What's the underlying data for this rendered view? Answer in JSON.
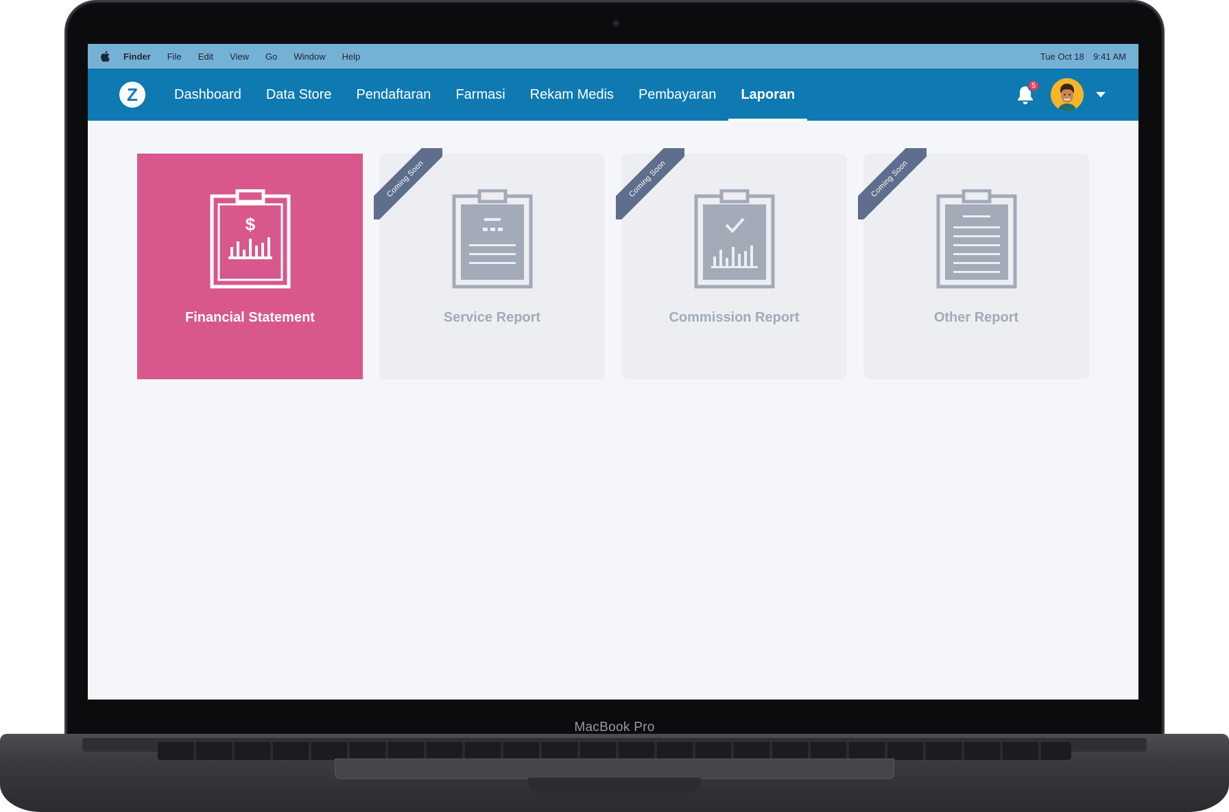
{
  "device": {
    "brand_label": "MacBook Pro"
  },
  "menubar": {
    "items": [
      {
        "label": "Finder",
        "bold": true
      },
      {
        "label": "File"
      },
      {
        "label": "Edit"
      },
      {
        "label": "View"
      },
      {
        "label": "Go"
      },
      {
        "label": "Window"
      },
      {
        "label": "Help"
      }
    ],
    "date": "Tue Oct 18",
    "time": "9:41 AM"
  },
  "navbar": {
    "logo_letter": "Z",
    "items": [
      {
        "label": "Dashboard"
      },
      {
        "label": "Data Store"
      },
      {
        "label": "Pendaftaran"
      },
      {
        "label": "Farmasi"
      },
      {
        "label": "Rekam Medis"
      },
      {
        "label": "Pembayaran"
      },
      {
        "label": "Laporan",
        "active": true
      }
    ],
    "notification_count": "5"
  },
  "cards": [
    {
      "label": "Financial Statement",
      "active": true,
      "ribbon": ""
    },
    {
      "label": "Service Report",
      "active": false,
      "ribbon": "Coming Soon"
    },
    {
      "label": "Commission Report",
      "active": false,
      "ribbon": "Coming Soon"
    },
    {
      "label": "Other Report",
      "active": false,
      "ribbon": "Coming Soon"
    }
  ],
  "colors": {
    "menubar": "#75b1d4",
    "navbar": "#0f79b1",
    "active_card": "#d8578c",
    "inactive_card": "#eceef2",
    "inactive_icon": "#a3aab8",
    "ribbon": "#5e6e8c",
    "badge": "#ef3b59"
  }
}
